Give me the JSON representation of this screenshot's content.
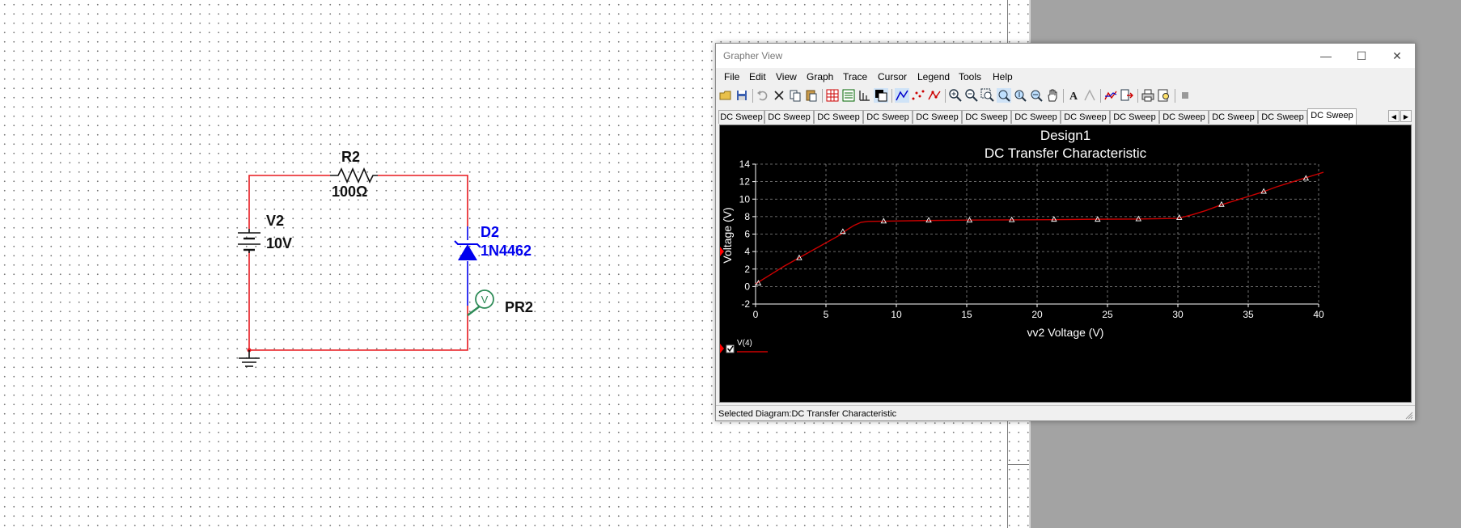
{
  "schematic": {
    "resistor": {
      "ref": "R2",
      "value": "100Ω"
    },
    "source": {
      "ref": "V2",
      "value": "10V"
    },
    "diode": {
      "ref": "D2",
      "model": "1N4462"
    },
    "probe": {
      "ref": "PR2",
      "symbol": "V"
    },
    "colors": {
      "wire": "#e8191f",
      "diode": "#0000ee",
      "probe": "#2e8b57"
    }
  },
  "grapher": {
    "title": "Grapher View",
    "window_buttons": {
      "minimize": "—",
      "maximize": "☐",
      "close": "✕"
    },
    "menu": [
      "File",
      "Edit",
      "View",
      "Graph",
      "Trace",
      "Cursor",
      "Legend",
      "Tools",
      "Help"
    ],
    "toolbar_icons": [
      "open-icon",
      "save-icon",
      "undo-icon",
      "cut-icon",
      "copy-icon",
      "paste-icon",
      "grid-icon",
      "legend-icon",
      "cursor-icon",
      "overlay-icon",
      "line-style-icon",
      "marker-icon",
      "dot-icon",
      "zoom-in-icon",
      "zoom-out-icon",
      "zoom-area-icon",
      "zoom-x-icon",
      "zoom-y-icon",
      "zoom-fit-icon",
      "pan-icon",
      "text-icon",
      "properties-icon",
      "trace-icon",
      "export-icon",
      "print-icon",
      "print-preview-icon",
      "stop-icon"
    ],
    "tabs": [
      "DC Sweep",
      "DC Sweep",
      "DC Sweep",
      "DC Sweep",
      "DC Sweep",
      "DC Sweep",
      "DC Sweep",
      "DC Sweep",
      "DC Sweep",
      "DC Sweep",
      "DC Sweep",
      "DC Sweep",
      "DC Sweep"
    ],
    "active_tab": 12,
    "tab_scroll": {
      "left": "◀",
      "right": "▶"
    },
    "status": "Selected Diagram:DC Transfer Characteristic",
    "legend": {
      "label": "V(4)",
      "checked": true
    }
  },
  "chart_data": {
    "type": "line",
    "title": "Design1",
    "subtitle": "DC Transfer Characteristic",
    "xlabel": "vv2 Voltage (V)",
    "ylabel": "Voltage (V)",
    "xlim": [
      0,
      40
    ],
    "ylim": [
      -2,
      14
    ],
    "xticks": [
      0,
      5,
      10,
      15,
      20,
      25,
      30,
      35,
      40
    ],
    "yticks": [
      -2,
      0,
      2,
      4,
      6,
      8,
      10,
      12,
      14
    ],
    "grid": true,
    "background": "#000000",
    "series": [
      {
        "name": "V(4)",
        "color": "#cc0000",
        "x": [
          0,
          1,
          2,
          3,
          4,
          5,
          6,
          6.5,
          7,
          7.5,
          8,
          10,
          12,
          15,
          18,
          21,
          24,
          27,
          30,
          31,
          32,
          33,
          34,
          35,
          36,
          37,
          38,
          39,
          40
        ],
        "y": [
          0.3,
          1.3,
          2.3,
          3.2,
          4.1,
          5.0,
          5.9,
          6.5,
          7.0,
          7.35,
          7.45,
          7.5,
          7.55,
          7.6,
          7.62,
          7.65,
          7.7,
          7.72,
          7.8,
          8.2,
          8.7,
          9.3,
          9.8,
          10.3,
          10.8,
          11.4,
          11.9,
          12.4,
          12.9
        ]
      }
    ],
    "markers": {
      "x": [
        0.2,
        3.1,
        6.2,
        9.1,
        12.3,
        15.2,
        18.2,
        21.2,
        24.3,
        27.2,
        30.1,
        33.1,
        36.1,
        39.1
      ],
      "y": [
        0.4,
        3.3,
        6.3,
        7.5,
        7.6,
        7.6,
        7.65,
        7.7,
        7.7,
        7.75,
        7.9,
        9.4,
        10.9,
        12.4
      ]
    }
  }
}
